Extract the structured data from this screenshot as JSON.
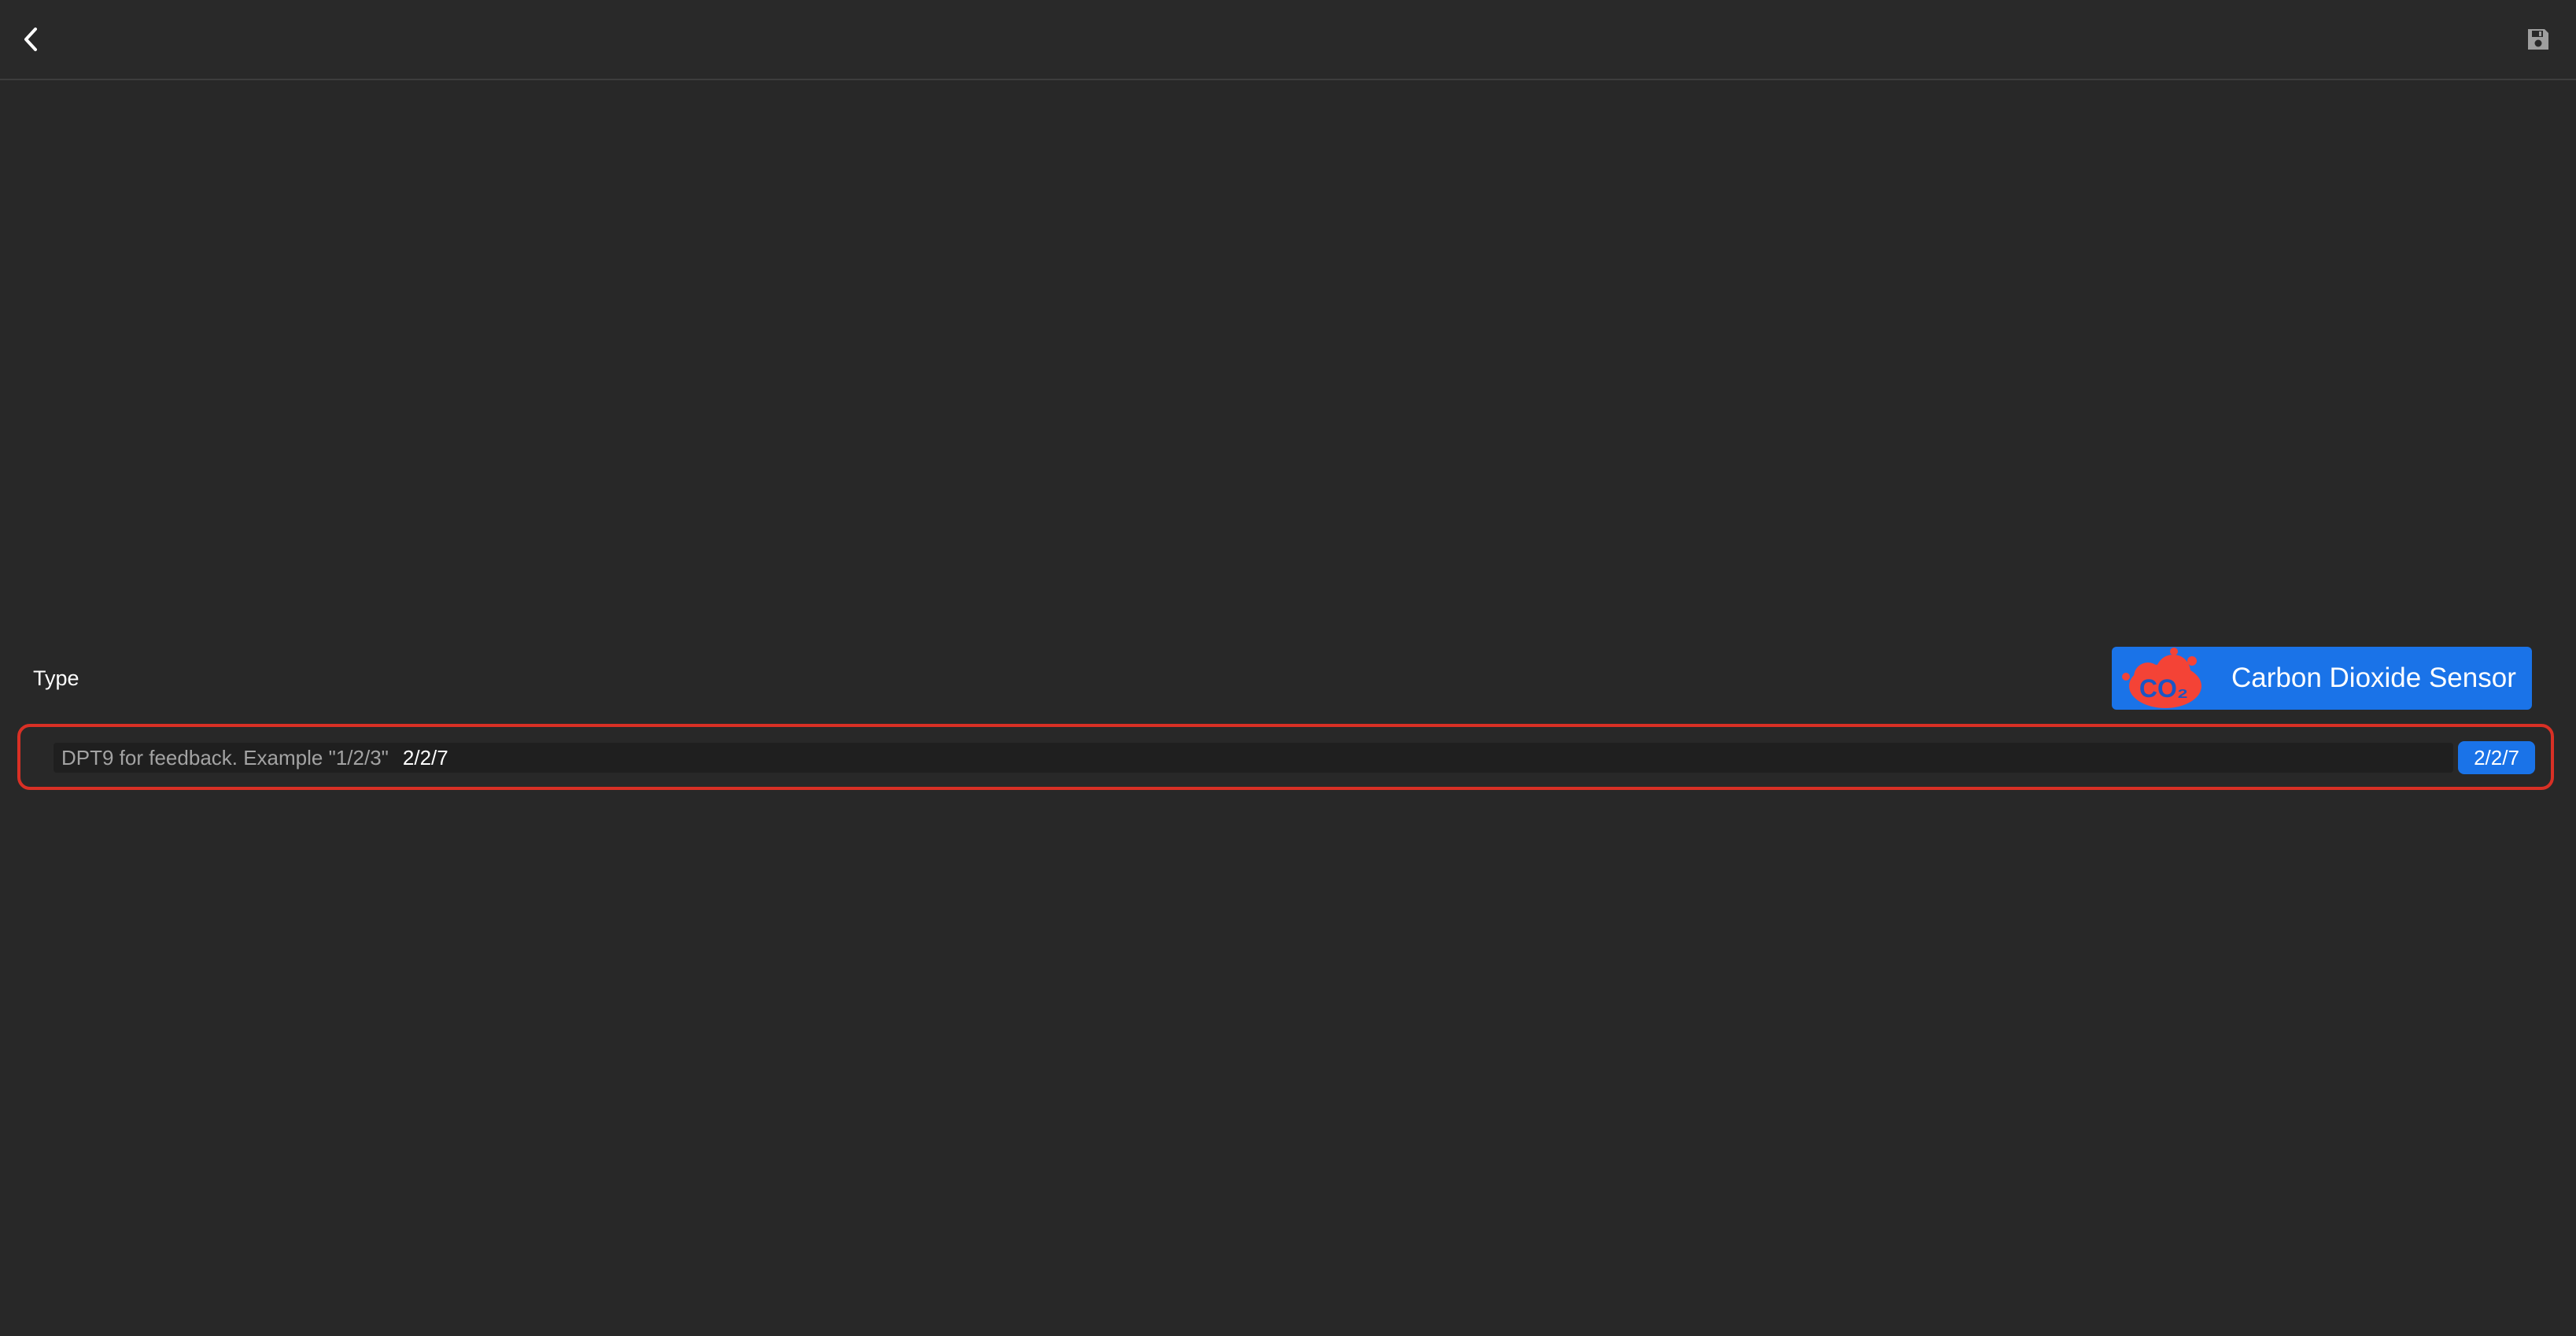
{
  "header": {
    "back_icon": "chevron-left-icon",
    "save_icon": "floppy-disk-icon"
  },
  "type_field": {
    "label": "Type",
    "selected_type": "Carbon Dioxide Sensor",
    "type_icon": "co2-cloud-icon",
    "type_icon_text": "CO₂",
    "chip_color": "#1a73e8",
    "icon_color": "#f44336"
  },
  "address_field": {
    "placeholder": "DPT9 for feedback. Example \"1/2/3\"",
    "value": "2/2/7",
    "badge": "2/2/7",
    "highlight_color": "#d93025"
  }
}
